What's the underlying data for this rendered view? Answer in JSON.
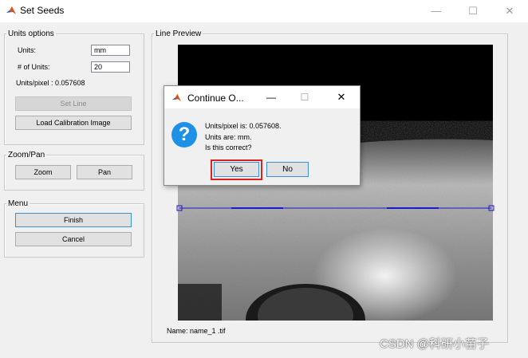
{
  "window": {
    "title": "Set Seeds",
    "minimize_glyph": "—",
    "maximize_glyph": "☐",
    "close_glyph": "✕"
  },
  "units_panel": {
    "title": "Units options",
    "units_label": "Units:",
    "units_value": "mm",
    "num_units_label": "# of Units:",
    "num_units_value": "20",
    "units_per_pixel": "Units/pixel : 0.057608",
    "set_line_label": "Set Line",
    "load_calibration_label": "Load Calibration Image"
  },
  "zoom_panel": {
    "title": "Zoom/Pan",
    "zoom_label": "Zoom",
    "pan_label": "Pan"
  },
  "menu_panel": {
    "title": "Menu",
    "finish_label": "Finish",
    "cancel_label": "Cancel"
  },
  "preview": {
    "title": "Line Preview",
    "file_name": "Name: name_1 .tif"
  },
  "dialog": {
    "title": "Continue O...",
    "minimize_glyph": "—",
    "maximize_glyph": "☐",
    "close_glyph": "✕",
    "icon_glyph": "?",
    "line1": "Units/pixel is: 0.057608.",
    "line2": "Units are: mm.",
    "line3": "Is this correct?",
    "yes_label": "Yes",
    "no_label": "No"
  },
  "watermark": "CSDN @科研小苗子",
  "colors": {
    "accent": "#3c8fd6",
    "highlight_box": "#e02020",
    "seed_line": "#1a1acc",
    "question_icon": "#1e90e6"
  }
}
